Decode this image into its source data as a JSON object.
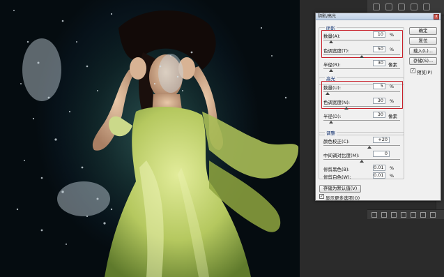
{
  "dialog": {
    "title": "阴影/高光",
    "close_label": "x",
    "shadows": {
      "group_label": "阴影",
      "amount_label": "数量(A):",
      "amount_value": "10",
      "amount_unit": "%",
      "amount_level": 0.1,
      "tone_label": "色调宽度(T):",
      "tone_value": "50",
      "tone_unit": "%",
      "tone_level": 0.5,
      "radius_label": "半径(R):",
      "radius_value": "30",
      "radius_unit": "像素",
      "radius_level": 0.1
    },
    "highlights": {
      "group_label": "高光",
      "amount_label": "数量(U):",
      "amount_value": "5",
      "amount_unit": "%",
      "amount_level": 0.05,
      "tone_label": "色调宽度(N):",
      "tone_value": "30",
      "tone_unit": "%",
      "tone_level": 0.3,
      "radius_label": "半径(D):",
      "radius_value": "30",
      "radius_unit": "像素",
      "radius_level": 0.1
    },
    "adjustments": {
      "group_label": "调整",
      "color_label": "颜色校正(C):",
      "color_value": "+20",
      "color_level": 0.6,
      "midtone_label": "中间调对比度(M):",
      "midtone_value": "0",
      "midtone_level": 0.5,
      "black_label": "修剪黑色(B):",
      "black_value": "0.01",
      "black_unit": "%",
      "white_label": "修剪白色(W):",
      "white_value": "0.01",
      "white_unit": "%"
    },
    "buttons": {
      "ok": "确定",
      "reset": "复位",
      "load": "载入(L)...",
      "save": "存储(S)...",
      "preview_label": "预览(P)",
      "save_default": "存储为默认值(V)",
      "more_options_label": "显示更多选项(O)"
    },
    "preview_checked": "✓",
    "more_options_checked": "✓"
  },
  "colors": {
    "highlight_border": "#c8202a",
    "dress": "#c7d77a",
    "water": "#0d2024"
  },
  "icons": [
    "fx-icon",
    "mask-icon",
    "adjustment-icon",
    "folder-icon",
    "new-layer-icon",
    "trash-icon"
  ]
}
